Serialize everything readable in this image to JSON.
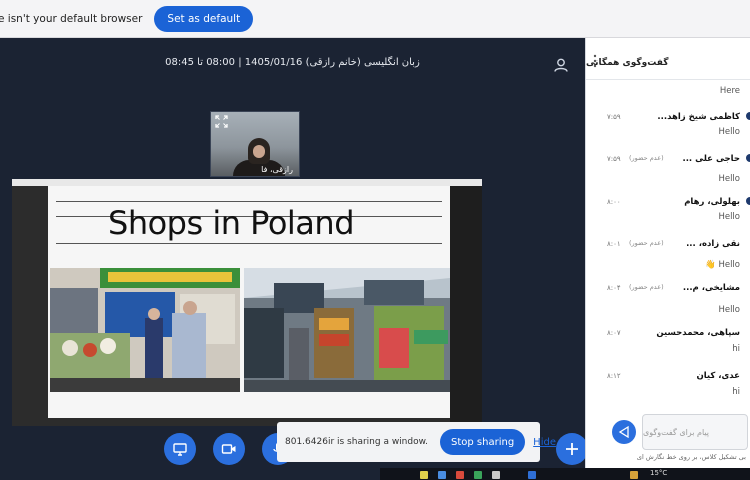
{
  "browser_notice": {
    "text": "e isn't your default browser",
    "button_label": "Set as default"
  },
  "meeting": {
    "title": "زبان انگلیسی (خانم رازقی) 1405/01/16 | 08:00 تا 08:45",
    "webcam_name": "رازقی، فا"
  },
  "slide": {
    "title": "Shops in Poland"
  },
  "controls": {
    "sharing_text": "801.6426ir is sharing a window.",
    "stop_label": "Stop sharing",
    "hide_label": "Hide"
  },
  "chat": {
    "header": "گفت‌وگوی همگانی",
    "messages": [
      {
        "name": "",
        "tag": "",
        "time": "",
        "text": "Here"
      },
      {
        "name": "کاظمی شیخ زاهد...",
        "tag": "",
        "time": "۷:۵۹",
        "text": "Hello"
      },
      {
        "name": "حاجی علی ...",
        "tag": "(عدم حضور)",
        "time": "۷:۵۹",
        "text": "Hello"
      },
      {
        "name": "بهلولی، رهام",
        "tag": "",
        "time": "۸:۰۰",
        "text": "Hello"
      },
      {
        "name": "نقی زاده، ...",
        "tag": "(عدم حضور)",
        "time": "۸:۰۱",
        "text": "👋 Hello"
      },
      {
        "name": "مشایخی، م...",
        "tag": "(عدم حضور)",
        "time": "۸:۰۴",
        "text": "Hello"
      },
      {
        "name": "سپاهی، محمدحسین",
        "tag": "",
        "time": "۸:۰۷",
        "text": "hi"
      },
      {
        "name": "عدی، کیان",
        "tag": "",
        "time": "۸:۱۲",
        "text": "hi"
      }
    ],
    "input_placeholder": "پیام برای گفت‌وگوی",
    "hint": "بی تشکیل کلاس، بر روی خط نگارش ای"
  },
  "taskbar": {
    "temperature": "15°C"
  },
  "colors": {
    "accent": "#2b6fde",
    "meeting_bg": "#1b2333"
  }
}
